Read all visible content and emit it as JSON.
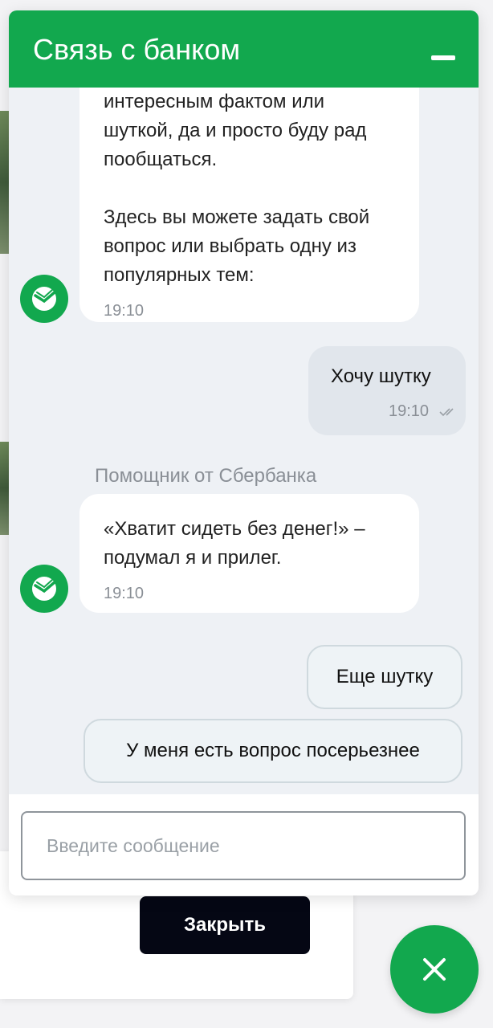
{
  "chat": {
    "title": "Связь с банком",
    "messages": [
      {
        "lines": [
          "интересным фактом или",
          "шуткой, да и просто буду рад",
          "пообщаться.",
          "",
          "Здесь вы можете задать свой",
          "вопрос или выбрать одну из",
          "популярных тем:"
        ],
        "time": "19:10"
      },
      {
        "text": "Хочу шутку",
        "time": "19:10"
      },
      {
        "sender": "Помощник от Сбербанка",
        "lines": [
          "«Хватит сидеть без денег!» –",
          "подумал я и прилег."
        ],
        "time": "19:10"
      }
    ],
    "quick_replies": [
      "Еще шутку",
      "У меня есть вопрос посерьезнее"
    ],
    "input": {
      "placeholder": "Введите сообщение",
      "value": ""
    }
  },
  "page": {
    "close_button": "Закрыть"
  },
  "colors": {
    "brand_green": "#12a84e",
    "dark_button": "#050714"
  },
  "icons": {
    "bot_avatar": "sber-logo-icon",
    "minimize": "minimize-icon",
    "fab": "close-icon",
    "read_status": "double-check-icon"
  }
}
